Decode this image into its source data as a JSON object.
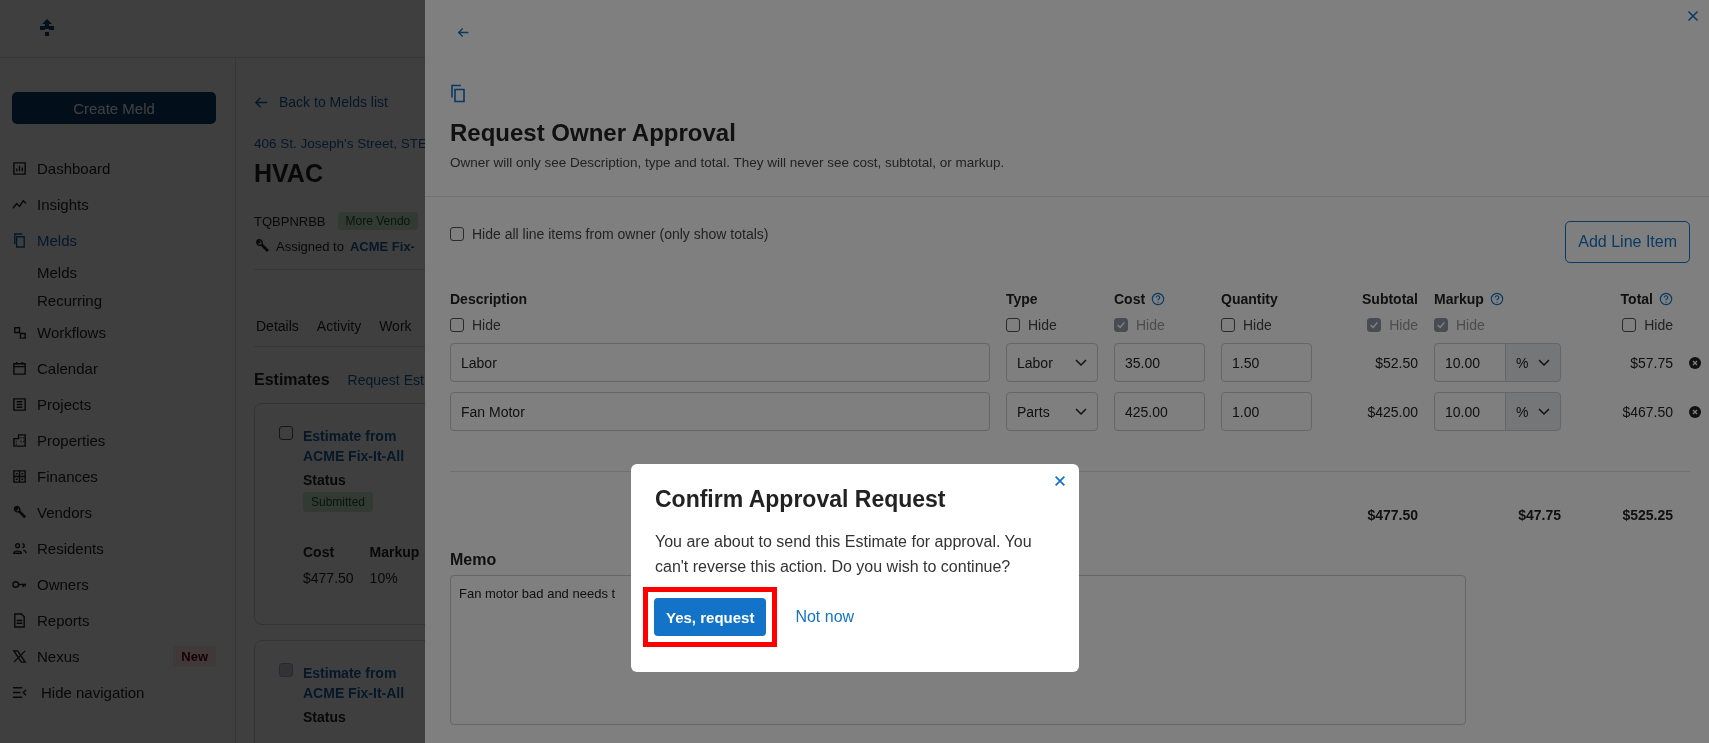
{
  "sidebar": {
    "create_button": "Create Meld",
    "items": [
      {
        "label": "Dashboard",
        "selected": false
      },
      {
        "label": "Insights",
        "selected": false
      },
      {
        "label": "Melds",
        "selected": true,
        "children": [
          {
            "label": "Melds",
            "selected": false
          },
          {
            "label": "Recurring",
            "selected": false
          }
        ]
      },
      {
        "label": "Workflows",
        "selected": false
      },
      {
        "label": "Calendar",
        "selected": false
      },
      {
        "label": "Projects",
        "selected": false
      },
      {
        "label": "Properties",
        "selected": false
      },
      {
        "label": "Finances",
        "selected": false
      },
      {
        "label": "Vendors",
        "selected": false
      },
      {
        "label": "Residents",
        "selected": false
      },
      {
        "label": "Owners",
        "selected": false
      },
      {
        "label": "Reports",
        "selected": false
      },
      {
        "label": "Nexus",
        "selected": false,
        "badge": "New"
      }
    ],
    "collapse": "Hide navigation"
  },
  "meld": {
    "back_link": "Back to Melds list",
    "address": "406 St. Joseph's Street, STE",
    "title": "HVAC",
    "code": "TQBPNRBB",
    "tag": "More Vendo",
    "assigned_label": "Assigned to",
    "assigned_to": "ACME Fix-",
    "tabs": [
      {
        "label": "Details",
        "selected": false
      },
      {
        "label": "Activity",
        "selected": false
      },
      {
        "label": "Work",
        "selected": false
      }
    ],
    "section_title": "Estimates",
    "section_link": "Request Est",
    "estimates": [
      {
        "checked": false,
        "disabled": false,
        "title": "Estimate from ACME Fix-It-All",
        "status_label": "Status",
        "status": "Submitted",
        "fields": [
          {
            "label": "Cost",
            "value": "$477.50"
          },
          {
            "label": "Markup",
            "value": "10%"
          }
        ]
      },
      {
        "checked": false,
        "disabled": true,
        "title": "Estimate from ACME Fix-It-All",
        "status_label": "Status"
      }
    ]
  },
  "drawer": {
    "title": "Request Owner Approval",
    "subtitle": "Owner will only see Description, type and total. They will never see cost, subtotal, or markup.",
    "hide_all": {
      "label": "Hide all line items from owner (only show totals)",
      "checked": false
    },
    "add_button": "Add Line Item",
    "columns": [
      {
        "label": "Description",
        "hide_label": "Hide",
        "hide_checked": false,
        "hide_disabled": false
      },
      {
        "label": "Type",
        "hide_label": "Hide",
        "hide_checked": false,
        "hide_disabled": false
      },
      {
        "label": "Cost",
        "help": true,
        "hide_label": "Hide",
        "hide_checked": true,
        "hide_disabled": true
      },
      {
        "label": "Quantity",
        "hide_label": "Hide",
        "hide_checked": false,
        "hide_disabled": false
      },
      {
        "label": "Subtotal",
        "hide_label": "Hide",
        "hide_checked": true,
        "hide_disabled": true
      },
      {
        "label": "Markup",
        "help": true,
        "hide_label": "Hide",
        "hide_checked": true,
        "hide_disabled": true
      },
      {
        "label": "Total",
        "help": true,
        "hide_label": "Hide",
        "hide_checked": false,
        "hide_disabled": false
      }
    ],
    "rows": [
      {
        "description": "Labor",
        "type": "Labor",
        "cost": "35.00",
        "quantity": "1.50",
        "subtotal": "$52.50",
        "markup": "10.00",
        "markup_unit": "%",
        "total": "$57.75"
      },
      {
        "description": "Fan Motor",
        "type": "Parts",
        "cost": "425.00",
        "quantity": "1.00",
        "subtotal": "$425.00",
        "markup": "10.00",
        "markup_unit": "%",
        "total": "$467.50"
      }
    ],
    "totals": {
      "subtotal": "$477.50",
      "markup": "$47.75",
      "total": "$525.25"
    },
    "memo_label": "Memo",
    "memo": "Fan motor bad and needs t"
  },
  "dialog": {
    "title": "Confirm Approval Request",
    "message": "You are about to send this Estimate for approval. You can't reverse this action. Do you wish to continue?",
    "confirm": "Yes, request",
    "confirm_highlighted": true,
    "cancel": "Not now"
  }
}
